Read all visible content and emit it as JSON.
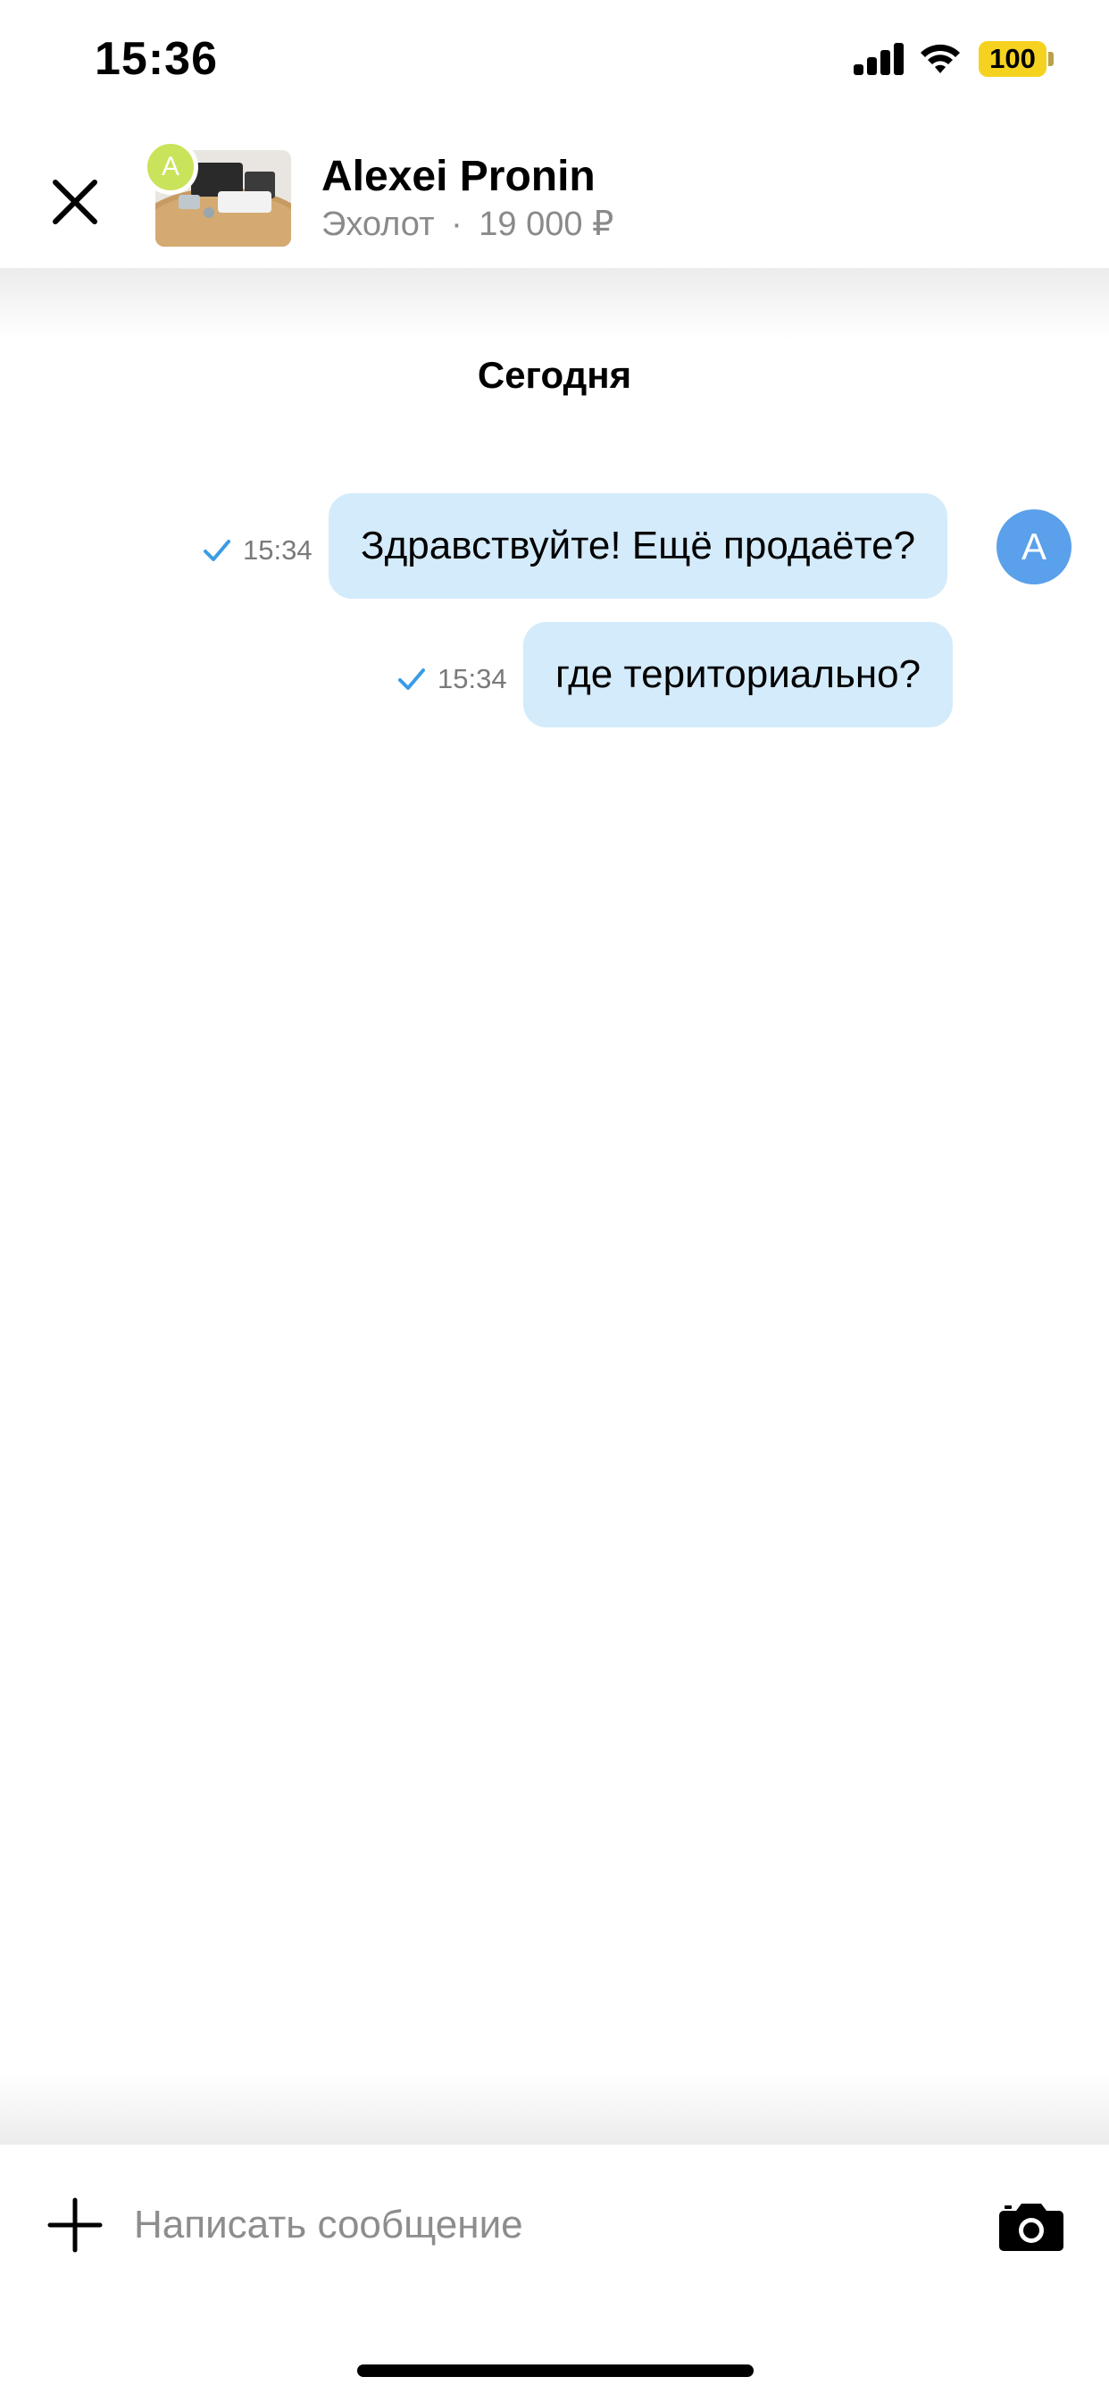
{
  "status_bar": {
    "time": "15:36",
    "battery": "100",
    "icons": [
      "signal-icon",
      "wifi-icon",
      "battery-icon"
    ]
  },
  "header": {
    "contact_name": "Alexei Pronin",
    "avatar_letter": "A",
    "item_title": "Эхолот",
    "separator": "·",
    "item_price": "19 000 ₽",
    "icons": [
      "close-icon"
    ]
  },
  "conversation": {
    "day_label": "Сегодня",
    "sender_avatar_letter": "A",
    "messages": [
      {
        "text": "Здравствуйте! Ещё продаёте?",
        "time": "15:34",
        "status": "sent"
      },
      {
        "text": "где териториально?",
        "time": "15:34",
        "status": "sent"
      }
    ]
  },
  "composer": {
    "placeholder": "Написать сообщение",
    "icons": [
      "plus-icon",
      "camera-icon"
    ]
  },
  "colors": {
    "bubble": "#d4ebfb",
    "check": "#3a9be6",
    "avatar": "#5aa0ea",
    "thumb_avatar": "#c9e35b",
    "battery": "#f5d21f"
  }
}
